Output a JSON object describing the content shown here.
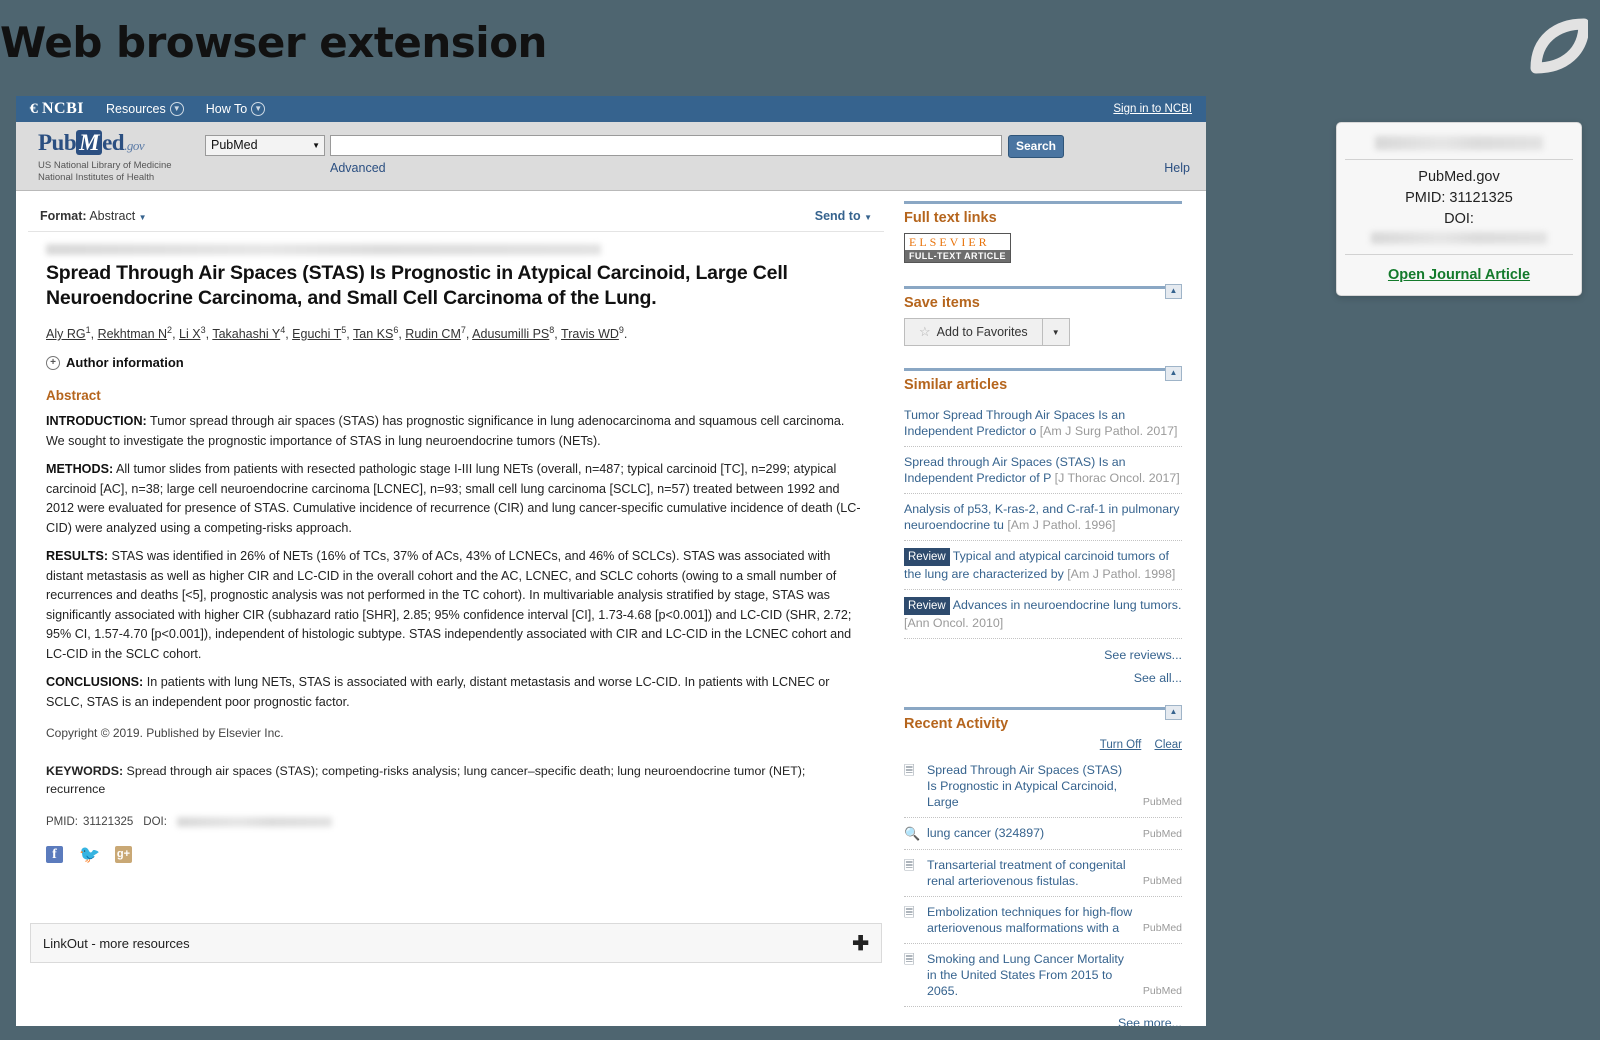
{
  "slide": {
    "title": "Web browser extension",
    "logo_icon": "leaf-logo-icon"
  },
  "ncbi_bar": {
    "logo": "NCBI",
    "menu": [
      {
        "label": "Resources",
        "icon": "chevron-down-icon"
      },
      {
        "label": "How To",
        "icon": "chevron-down-icon"
      }
    ],
    "signin": "Sign in to NCBI"
  },
  "masthead": {
    "logo_pub": "Pub",
    "logo_m": "M",
    "logo_ed": "ed",
    "logo_gov": ".gov",
    "subtitle_line1": "US National Library of Medicine",
    "subtitle_line2": "National Institutes of Health",
    "db_selected": "PubMed",
    "search_value": "",
    "search_placeholder": "",
    "search_button": "Search",
    "advanced": "Advanced",
    "help": "Help"
  },
  "toolbar": {
    "format_label": "Format:",
    "format_value": "Abstract",
    "send_to": "Send to"
  },
  "article": {
    "citation_redacted": true,
    "title": "Spread Through Air Spaces (STAS) Is Prognostic in Atypical Carcinoid, Large Cell Neuroendocrine Carcinoma, and Small Cell Carcinoma of the Lung.",
    "authors": [
      {
        "name": "Aly RG",
        "sup": "1"
      },
      {
        "name": "Rekhtman N",
        "sup": "2"
      },
      {
        "name": "Li X",
        "sup": "3"
      },
      {
        "name": "Takahashi Y",
        "sup": "4"
      },
      {
        "name": "Eguchi T",
        "sup": "5"
      },
      {
        "name": "Tan KS",
        "sup": "6"
      },
      {
        "name": "Rudin CM",
        "sup": "7"
      },
      {
        "name": "Adusumilli PS",
        "sup": "8"
      },
      {
        "name": "Travis WD",
        "sup": "9"
      }
    ],
    "author_information": "Author information",
    "abstract_heading": "Abstract",
    "sections": [
      {
        "label": "INTRODUCTION:",
        "text": " Tumor spread through air spaces (STAS) has prognostic significance in lung adenocarcinoma and squamous cell carcinoma. We sought to investigate the prognostic importance of STAS in lung neuroendocrine tumors (NETs)."
      },
      {
        "label": "METHODS:",
        "text": " All tumor slides from patients with resected pathologic stage I-III lung NETs (overall, n=487; typical carcinoid [TC], n=299; atypical carcinoid [AC], n=38; large cell neuroendocrine carcinoma [LCNEC], n=93; small cell lung carcinoma [SCLC], n=57) treated between 1992 and 2012 were evaluated for presence of STAS. Cumulative incidence of recurrence (CIR) and lung cancer-specific cumulative incidence of death (LC-CID) were analyzed using a competing-risks approach."
      },
      {
        "label": "RESULTS:",
        "text": " STAS was identified in 26% of NETs (16% of TCs, 37% of ACs, 43% of LCNECs, and 46% of SCLCs). STAS was associated with distant metastasis as well as higher CIR and LC-CID in the overall cohort and the AC, LCNEC, and SCLC cohorts (owing to a small number of recurrences and deaths [<5], prognostic analysis was not performed in the TC cohort). In multivariable analysis stratified by stage, STAS was significantly associated with higher CIR (subhazard ratio [SHR], 2.85; 95% confidence interval [CI], 1.73-4.68 [p<0.001]) and LC-CID (SHR, 2.72; 95% CI, 1.57-4.70 [p<0.001]), independent of histologic subtype. STAS independently associated with CIR and LC-CID in the LCNEC cohort and LC-CID in the SCLC cohort."
      },
      {
        "label": "CONCLUSIONS:",
        "text": " In patients with lung NETs, STAS is associated with early, distant metastasis and worse LC-CID. In patients with LCNEC or SCLC, STAS is an independent poor prognostic factor."
      }
    ],
    "copyright": "Copyright © 2019. Published by Elsevier Inc.",
    "keywords_label": "KEYWORDS:",
    "keywords_text": " Spread through air spaces (STAS); competing-risks analysis; lung cancer–specific death; lung neuroendocrine tumor (NET); recurrence",
    "pmid_label": "PMID:",
    "pmid_value": "31121325",
    "doi_label": "DOI:",
    "doi_redacted": true,
    "social": [
      {
        "name": "facebook-icon",
        "glyph": "f"
      },
      {
        "name": "twitter-icon",
        "glyph": "🐦"
      },
      {
        "name": "google-plus-icon",
        "glyph": "g+"
      }
    ]
  },
  "linkout": {
    "label": "LinkOut - more resources",
    "expand_icon": "plus-icon"
  },
  "sidebar": {
    "full_text": {
      "title": "Full text links",
      "publisher_top": "ELSEVIER",
      "publisher_bottom": "FULL-TEXT ARTICLE"
    },
    "save_items": {
      "title": "Save items",
      "button": "Add to Favorites",
      "star_icon": "star-icon",
      "caret_icon": "chevron-down-icon"
    },
    "similar_articles": {
      "title": "Similar articles",
      "items": [
        {
          "tag": "",
          "title": "Tumor Spread Through Air Spaces Is an Independent Predictor o",
          "source": "[Am J Surg Pathol. 2017]"
        },
        {
          "tag": "",
          "title": "Spread through Air Spaces (STAS) Is an Independent Predictor of P",
          "source": "[J Thorac Oncol. 2017]"
        },
        {
          "tag": "",
          "title": "Analysis of p53, K-ras-2, and C-raf-1 in pulmonary neuroendocrine tu",
          "source": "[Am J Pathol. 1996]"
        },
        {
          "tag": "Review",
          "title": "Typical and atypical carcinoid tumors of the lung are characterized by",
          "source": "[Am J Pathol. 1998]"
        },
        {
          "tag": "Review",
          "title": "Advances in neuroendocrine lung tumors.",
          "source": "[Ann Oncol. 2010]"
        }
      ],
      "see_reviews": "See reviews...",
      "see_all": "See all..."
    },
    "recent_activity": {
      "title": "Recent Activity",
      "turn_off": "Turn Off",
      "clear": "Clear",
      "items": [
        {
          "icon": "document-icon",
          "text": "Spread Through Air Spaces (STAS) Is Prognostic in Atypical Carcinoid, Large",
          "db": "PubMed"
        },
        {
          "icon": "search-icon",
          "text": "lung cancer (324897)",
          "db": "PubMed"
        },
        {
          "icon": "document-icon",
          "text": "Transarterial treatment of congenital renal arteriovenous fistulas.",
          "db": "PubMed"
        },
        {
          "icon": "document-icon",
          "text": "Embolization techniques for high-flow arteriovenous malformations with a",
          "db": "PubMed"
        },
        {
          "icon": "document-icon",
          "text": "Smoking and Lung Cancer Mortality in the United States From 2015 to 2065.",
          "db": "PubMed"
        }
      ],
      "see_more": "See more..."
    }
  },
  "extension_popup": {
    "header_redacted": true,
    "site": "PubMed.gov",
    "pmid": "PMID: 31121325",
    "doi_label": "DOI:",
    "doi_redacted": true,
    "open_link": "Open Journal Article"
  },
  "colors": {
    "slide_bg": "#4e6570",
    "ncbi_blue": "#36638e",
    "panel_heading": "#b5651d",
    "link_blue": "#36638e",
    "green_link": "#137a2b",
    "elsevier_orange": "#e8730b"
  }
}
